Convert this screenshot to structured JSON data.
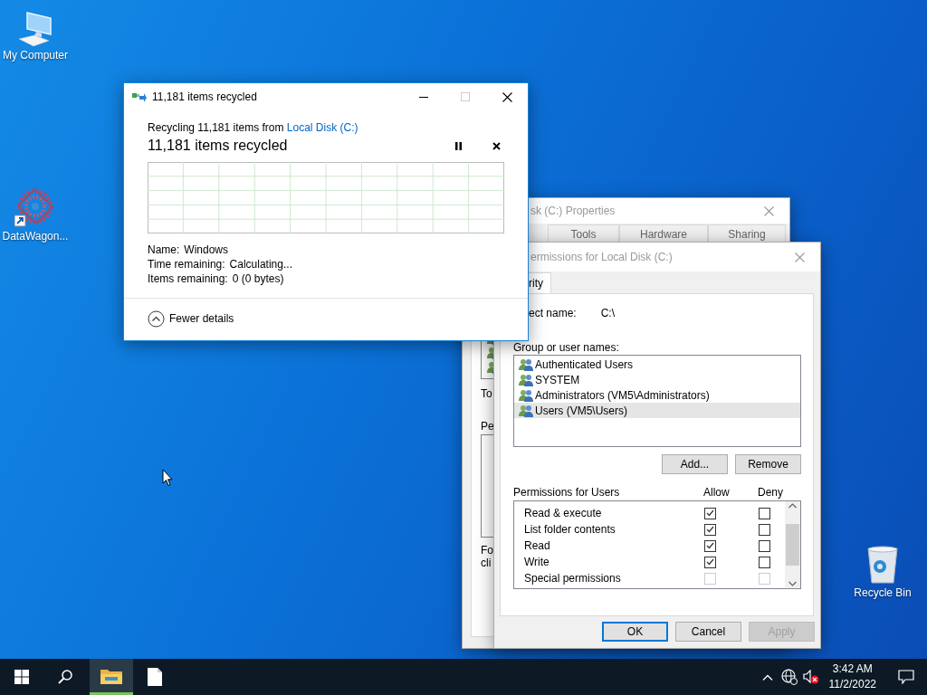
{
  "desktop_icons": [
    {
      "kind": "computer",
      "label": "My Computer"
    },
    {
      "kind": "shortcut",
      "label": "DataWagon..."
    },
    {
      "kind": "recycle",
      "label": "Recycle Bin"
    }
  ],
  "properties_window": {
    "title": "sk (C:) Properties",
    "tabs": [
      {
        "label": "Tools"
      },
      {
        "label": "Hardware"
      },
      {
        "label": "Sharing"
      }
    ],
    "fragments": [
      "To",
      "Pe",
      "Fo",
      "cli"
    ]
  },
  "permissions_window": {
    "title": "ermissions for Local Disk (C:)",
    "tab": {
      "label": "rity",
      "selected": true
    },
    "object_name_label": "ect name:",
    "object_name": "C:\\",
    "group_label": "Group or user names:",
    "users": [
      {
        "name": "Authenticated Users",
        "selected": false
      },
      {
        "name": "SYSTEM",
        "selected": false
      },
      {
        "name": "Administrators (VM5\\Administrators)",
        "selected": false
      },
      {
        "name": "Users (VM5\\Users)",
        "selected": true
      }
    ],
    "list_buttons": [
      "Add...",
      "Remove"
    ],
    "permissions_label": "Permissions for Users",
    "allow_header": "Allow",
    "deny_header": "Deny",
    "permissions": [
      {
        "name": "Read & execute",
        "allow": true,
        "deny": false,
        "disabled": false
      },
      {
        "name": "List folder contents",
        "allow": true,
        "deny": false,
        "disabled": false
      },
      {
        "name": "Read",
        "allow": true,
        "deny": false,
        "disabled": false
      },
      {
        "name": "Write",
        "allow": true,
        "deny": false,
        "disabled": false
      },
      {
        "name": "Special permissions",
        "allow": false,
        "deny": false,
        "disabled": true
      }
    ],
    "dialog_buttons": [
      {
        "label": "OK",
        "default": true,
        "disabled": false
      },
      {
        "label": "Cancel",
        "default": false,
        "disabled": false
      },
      {
        "label": "Apply",
        "default": false,
        "disabled": true
      }
    ]
  },
  "recycle_dialog": {
    "title": "11,181 items recycled",
    "source_text": "Recycling 11,181 items from ",
    "source_link": "Local Disk (C:)",
    "heading": "11,181 items recycled",
    "details": [
      {
        "label": "Name:",
        "value": "Windows"
      },
      {
        "label": "Time remaining:",
        "value": "Calculating..."
      },
      {
        "label": "Items remaining:",
        "value": "0 (0 bytes)"
      }
    ],
    "toggle": "Fewer details"
  },
  "taskbar": {
    "apps": [
      {
        "kind": "explorer",
        "selected": true
      },
      {
        "kind": "document",
        "selected": false
      }
    ],
    "time": "3:42 AM",
    "date": "11/2/2022"
  }
}
